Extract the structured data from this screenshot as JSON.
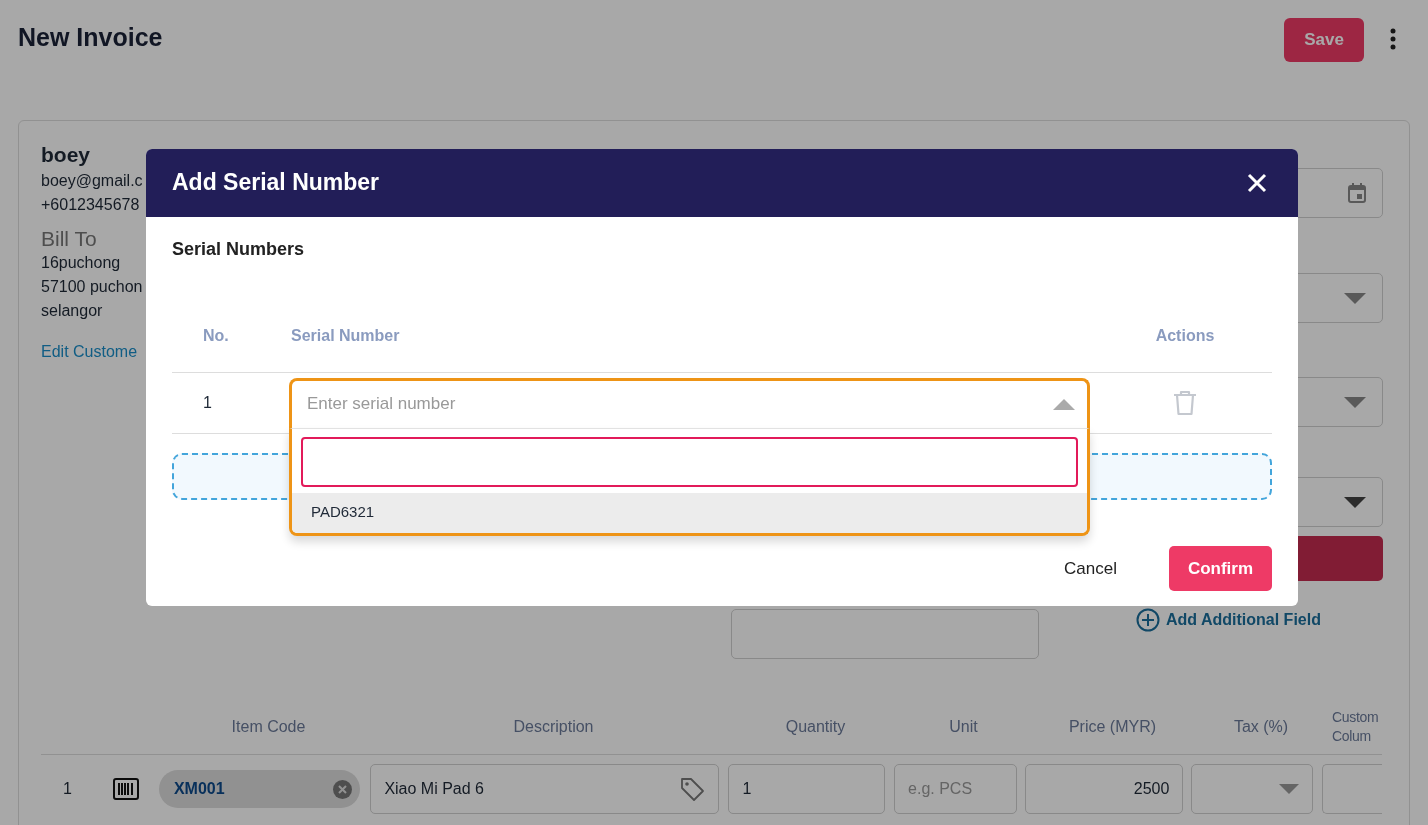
{
  "page": {
    "title": "New Invoice",
    "save_button": "Save"
  },
  "customer": {
    "name": "boey",
    "email": "boey@gmail.c",
    "phone": "+6012345678",
    "bill_to_label": "Bill To",
    "address_lines": [
      "16puchong",
      "57100 puchon",
      "selangor"
    ],
    "edit_link": "Edit Custome"
  },
  "add_field_link": "Add Additional Field",
  "items": {
    "columns": [
      "Item Code",
      "Description",
      "Quantity",
      "Unit",
      "Price (MYR)",
      "Tax (%)",
      "Custom Colum"
    ],
    "rows": [
      {
        "no": "1",
        "item_code": "XM001",
        "description": "Xiao Mi Pad 6",
        "quantity": "1",
        "unit_placeholder": "e.g. PCS",
        "price": "2500"
      }
    ]
  },
  "modal": {
    "title": "Add Serial Number",
    "section": "Serial Numbers",
    "columns": [
      "No.",
      "Serial Number",
      "Actions"
    ],
    "rows": [
      {
        "no": "1",
        "placeholder": "Enter serial number",
        "expanded": true
      }
    ],
    "options": [
      {
        "label": "PAD6321",
        "selected": true
      }
    ],
    "cancel": "Cancel",
    "confirm": "Confirm"
  }
}
